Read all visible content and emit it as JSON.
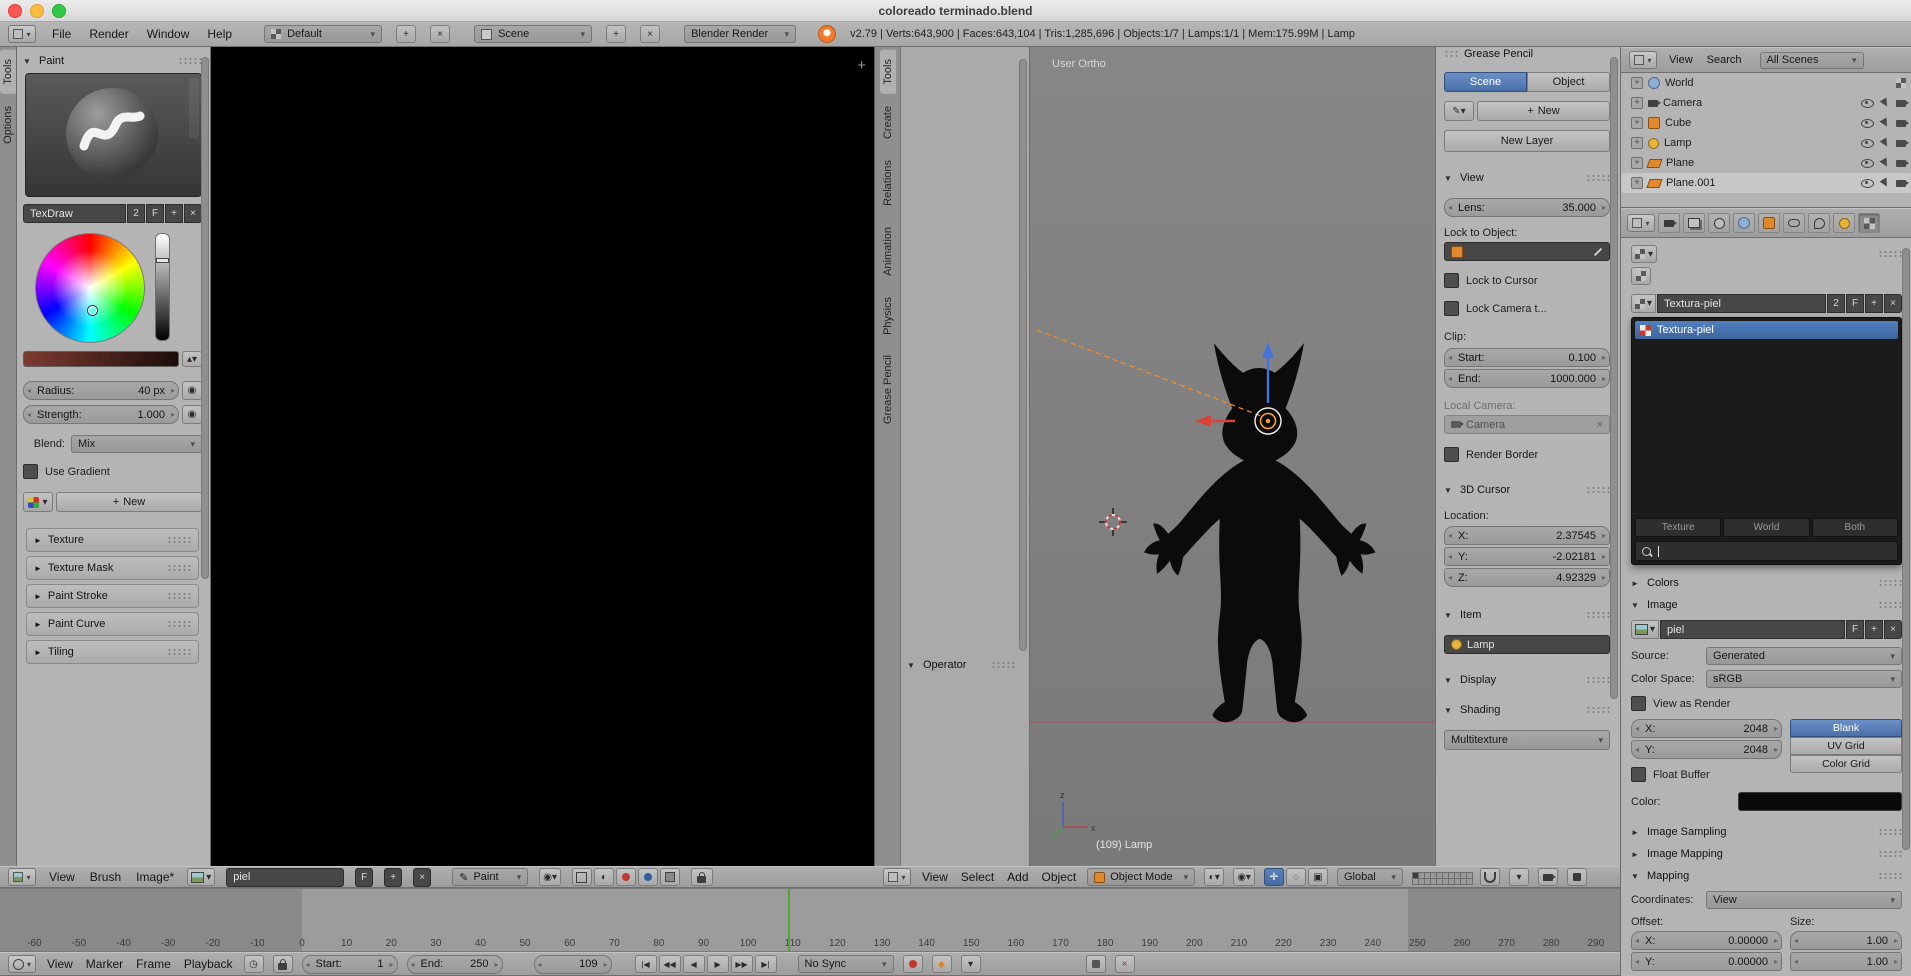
{
  "titlebar": {
    "title": "coloreado terminado.blend"
  },
  "infobar": {
    "menus": [
      "File",
      "Render",
      "Window",
      "Help"
    ],
    "layout_name": "Default",
    "scene_name": "Scene",
    "engine": "Blender Render",
    "stats": "v2.79 | Verts:643,900 | Faces:643,104 | Tris:1,285,696 | Objects:1/7 | Lamps:1/1 | Mem:175.99M | Lamp"
  },
  "paint_shelf": {
    "tabs": [
      "Tools",
      "Options"
    ],
    "panel_title": "Paint",
    "brush": {
      "name": "TexDraw",
      "users": "2",
      "fake_user": "F"
    },
    "radius": {
      "label": "Radius:",
      "value": "40 px"
    },
    "strength": {
      "label": "Strength:",
      "value": "1.000"
    },
    "blend": {
      "label": "Blend:",
      "value": "Mix"
    },
    "use_gradient_label": "Use Gradient",
    "palette_new_label": "New",
    "sections": [
      "Texture",
      "Texture Mask",
      "Paint Stroke",
      "Paint Curve",
      "Tiling"
    ]
  },
  "shelf3d": {
    "tabs": [
      "Tools",
      "Create",
      "Relations",
      "Animation",
      "Physics",
      "Grease Pencil"
    ],
    "operator_label": "Operator"
  },
  "viewport": {
    "view_label": "User Ortho",
    "status_label": "(109) Lamp"
  },
  "npanel": {
    "grease_pencil_title": "Grease Pencil",
    "gp_tabs": [
      "Scene",
      "Object"
    ],
    "new_label": "New",
    "new_layer_label": "New Layer",
    "view_title": "View",
    "lens": {
      "label": "Lens:",
      "value": "35.000"
    },
    "lock_to_object_label": "Lock to Object:",
    "lock_to_cursor_label": "Lock to Cursor",
    "lock_camera_label": "Lock Camera t...",
    "clip_label": "Clip:",
    "clip_start": {
      "label": "Start:",
      "value": "0.100"
    },
    "clip_end": {
      "label": "End:",
      "value": "1000.000"
    },
    "local_camera_label": "Local Camera:",
    "camera_name": "Camera",
    "render_border_label": "Render Border",
    "cursor_title": "3D Cursor",
    "location_label": "Location:",
    "loc_x": {
      "label": "X:",
      "value": "2.37545"
    },
    "loc_y": {
      "label": "Y:",
      "value": "-2.02181"
    },
    "loc_z": {
      "label": "Z:",
      "value": "4.92329"
    },
    "item_title": "Item",
    "item_name": "Lamp",
    "display_title": "Display",
    "shading_title": "Shading",
    "shading_mode": "Multitexture"
  },
  "outliner": {
    "menus": [
      "View",
      "Search"
    ],
    "scope": "All Scenes",
    "items": [
      {
        "name": "World"
      },
      {
        "name": "Camera"
      },
      {
        "name": "Cube"
      },
      {
        "name": "Lamp"
      },
      {
        "name": "Plane"
      },
      {
        "name": "Plane.001"
      }
    ]
  },
  "properties": {
    "texture_name": "Textura-piel",
    "texture_users": "2",
    "fake_user": "F",
    "browser_selected": "Textura-piel",
    "filter_buttons": [
      "Texture",
      "World",
      "Both"
    ],
    "colors_title": "Colors",
    "image_title": "Image",
    "image_name": "piel",
    "source_label": "Source:",
    "source_value": "Generated",
    "colorspace_label": "Color Space:",
    "colorspace_value": "sRGB",
    "view_as_render_label": "View as Render",
    "size_x": {
      "label": "X:",
      "value": "2048"
    },
    "size_y": {
      "label": "Y:",
      "value": "2048"
    },
    "generated_types": [
      "Blank",
      "UV Grid",
      "Color Grid"
    ],
    "float_buffer_label": "Float Buffer",
    "color_label": "Color:",
    "sampling_title": "Image Sampling",
    "img_mapping_title": "Image Mapping",
    "mapping_title": "Mapping",
    "coordinates_label": "Coordinates:",
    "coordinates_value": "View",
    "offset_label": "Offset:",
    "size_label": "Size:",
    "offset_x": {
      "label": "X:",
      "value": "0.00000"
    },
    "offset_y": {
      "label": "Y:",
      "value": "0.00000"
    },
    "scale_x": "1.00",
    "scale_y": "1.00"
  },
  "image_header": {
    "menus": [
      "View",
      "Brush",
      "Image*"
    ],
    "image_name": "piel",
    "mode_label": "Paint"
  },
  "v3d_header": {
    "menus": [
      "View",
      "Select",
      "Add",
      "Object"
    ],
    "mode_label": "Object Mode",
    "orientation": "Global"
  },
  "timeline": {
    "ticks": [
      -60,
      -50,
      -40,
      -30,
      -20,
      -10,
      0,
      10,
      20,
      30,
      40,
      50,
      60,
      70,
      80,
      90,
      100,
      110,
      120,
      130,
      140,
      150,
      160,
      170,
      180,
      190,
      200,
      210,
      220,
      230,
      240,
      250,
      260,
      270,
      280,
      290
    ],
    "current_frame": 109,
    "menus": [
      "View",
      "Marker",
      "Frame",
      "Playback"
    ],
    "start": {
      "label": "Start:",
      "value": "1"
    },
    "end": {
      "label": "End:",
      "value": "250"
    },
    "frame_value": "109",
    "playback": [
      "|◀",
      "◀◀",
      "◀",
      "▶",
      "▶▶",
      "▶|"
    ],
    "sync_label": "No Sync"
  }
}
